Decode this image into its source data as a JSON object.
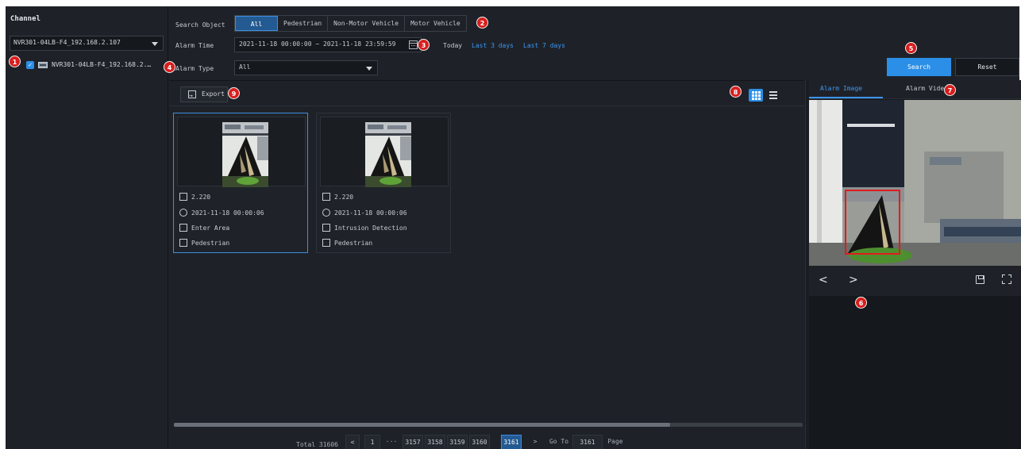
{
  "sidebar": {
    "title": "Channel",
    "device_select": "NVR301-04LB-F4_192.168.2.107",
    "tree_item": "NVR301-04LB-F4_192.168.2.…"
  },
  "filters": {
    "search_object_label": "Search Object",
    "search_objects": [
      "All",
      "Pedestrian",
      "Non-Motor Vehicle",
      "Motor Vehicle"
    ],
    "alarm_time_label": "Alarm Time",
    "alarm_time_value": "2021-11-18 00:00:00 ~ 2021-11-18 23:59:59",
    "quick_today": "Today",
    "quick_last3": "Last 3 days",
    "quick_last7": "Last 7 days",
    "alarm_type_label": "Alarm Type",
    "alarm_type_value": "All",
    "search_button": "Search",
    "reset_button": "Reset"
  },
  "toolbar": {
    "export_button": "Export"
  },
  "results": [
    {
      "channel": "2.220",
      "time": "2021-11-18 00:00:06",
      "event": "Enter Area",
      "object": "Pedestrian",
      "selected": true
    },
    {
      "channel": "2.220",
      "time": "2021-11-18 00:00:06",
      "event": "Intrusion Detection",
      "object": "Pedestrian",
      "selected": false
    }
  ],
  "pagination": {
    "total_label": "Total 31606",
    "prev": "<",
    "pages": [
      "1",
      "···",
      "3157",
      "3158",
      "3159",
      "3160",
      "3161"
    ],
    "current_page": "3161",
    "next": ">",
    "goto_label": "Go To",
    "goto_value": "3161",
    "page_label": "Page"
  },
  "preview": {
    "tab_image": "Alarm Image",
    "tab_video": "Alarm Video",
    "prev_arrow": "<",
    "next_arrow": ">"
  },
  "badges": [
    "1",
    "2",
    "3",
    "4",
    "5",
    "6",
    "7",
    "8",
    "9"
  ],
  "colors": {
    "accent": "#2b8fe8",
    "badge": "#d81e1e",
    "background": "#1e2228",
    "link": "#3d95f0"
  }
}
